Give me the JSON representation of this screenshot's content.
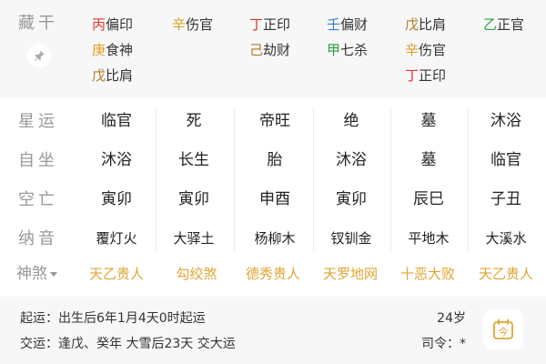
{
  "colors": {
    "wood": "#2aa146",
    "fire": "#d93a2b",
    "earth": "#b07a2a",
    "metal": "#d9a020",
    "water": "#3a7fd5",
    "accent": "#e0a533",
    "label": "#999999"
  },
  "canggan": {
    "label": "藏干",
    "pin_icon": "pin-icon",
    "columns": [
      [
        {
          "stem": "丙",
          "god": "偏印",
          "color": "#d93a2b"
        },
        {
          "stem": "庚",
          "god": "食神",
          "color": "#d9a020"
        },
        {
          "stem": "戊",
          "god": "比肩",
          "color": "#b07a2a"
        }
      ],
      [
        {
          "stem": "辛",
          "god": "伤官",
          "color": "#d9a020"
        }
      ],
      [
        {
          "stem": "丁",
          "god": "正印",
          "color": "#d93a2b"
        },
        {
          "stem": "己",
          "god": "劫财",
          "color": "#b07a2a"
        }
      ],
      [
        {
          "stem": "壬",
          "god": "偏财",
          "color": "#3a7fd5"
        },
        {
          "stem": "甲",
          "god": "七杀",
          "color": "#2aa146"
        }
      ],
      [
        {
          "stem": "戊",
          "god": "比肩",
          "color": "#b07a2a"
        },
        {
          "stem": "辛",
          "god": "伤官",
          "color": "#d9a020"
        },
        {
          "stem": "丁",
          "god": "正印",
          "color": "#d93a2b"
        }
      ],
      [
        {
          "stem": "乙",
          "god": "正官",
          "color": "#2aa146"
        }
      ]
    ]
  },
  "rows": [
    {
      "label": "星运",
      "cells": [
        "临官",
        "死",
        "帝旺",
        "绝",
        "墓",
        "沐浴"
      ]
    },
    {
      "label": "自坐",
      "cells": [
        "沐浴",
        "长生",
        "胎",
        "沐浴",
        "墓",
        "临官"
      ]
    },
    {
      "label": "空亡",
      "cells": [
        "寅卯",
        "寅卯",
        "申酉",
        "寅卯",
        "辰巳",
        "子丑"
      ]
    },
    {
      "label": "纳音",
      "cells": [
        "覆灯火",
        "大驿土",
        "杨柳木",
        "钗钏金",
        "平地木",
        "大溪水"
      ]
    }
  ],
  "shensha": {
    "label": "神煞",
    "cells": [
      "天乙贵人",
      "勾绞煞",
      "德秀贵人",
      "天罗地网",
      "十恶大败",
      "天乙贵人"
    ]
  },
  "info": {
    "qiyun": "起运：出生后6年1月4天0时起运",
    "jiaoyun": "交运：逢戊、癸年 大雪后23天 交大运",
    "age": "24岁",
    "siling": "司令：*",
    "calendar_icon": "calendar-today-icon",
    "calendar_glyph": "今"
  }
}
